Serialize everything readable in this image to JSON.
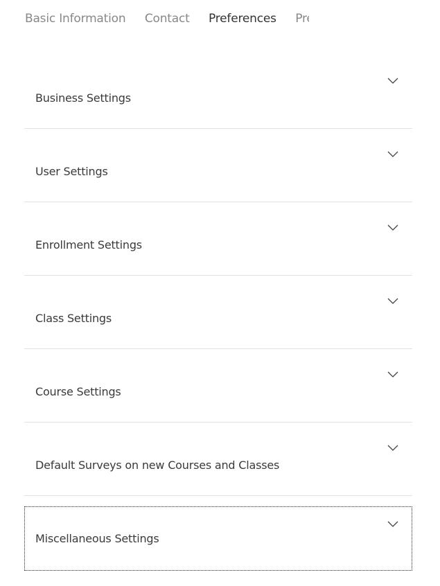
{
  "tabs": [
    {
      "label": "Basic Information",
      "active": false
    },
    {
      "label": "Contact",
      "active": false
    },
    {
      "label": "Preferences",
      "active": true
    },
    {
      "label": "Preferences",
      "active": false
    }
  ],
  "sections": [
    {
      "label": "Business Settings"
    },
    {
      "label": "User Settings"
    },
    {
      "label": "Enrollment Settings"
    },
    {
      "label": "Class Settings"
    },
    {
      "label": "Course Settings"
    },
    {
      "label": "Default Surveys on new Courses and Classes"
    },
    {
      "label": "Miscellaneous Settings"
    }
  ],
  "colors": {
    "text": "#333333",
    "muted_tab": "#888888",
    "divider": "#e1e1e1"
  },
  "icons": {
    "expand": "chevron-down-icon"
  }
}
